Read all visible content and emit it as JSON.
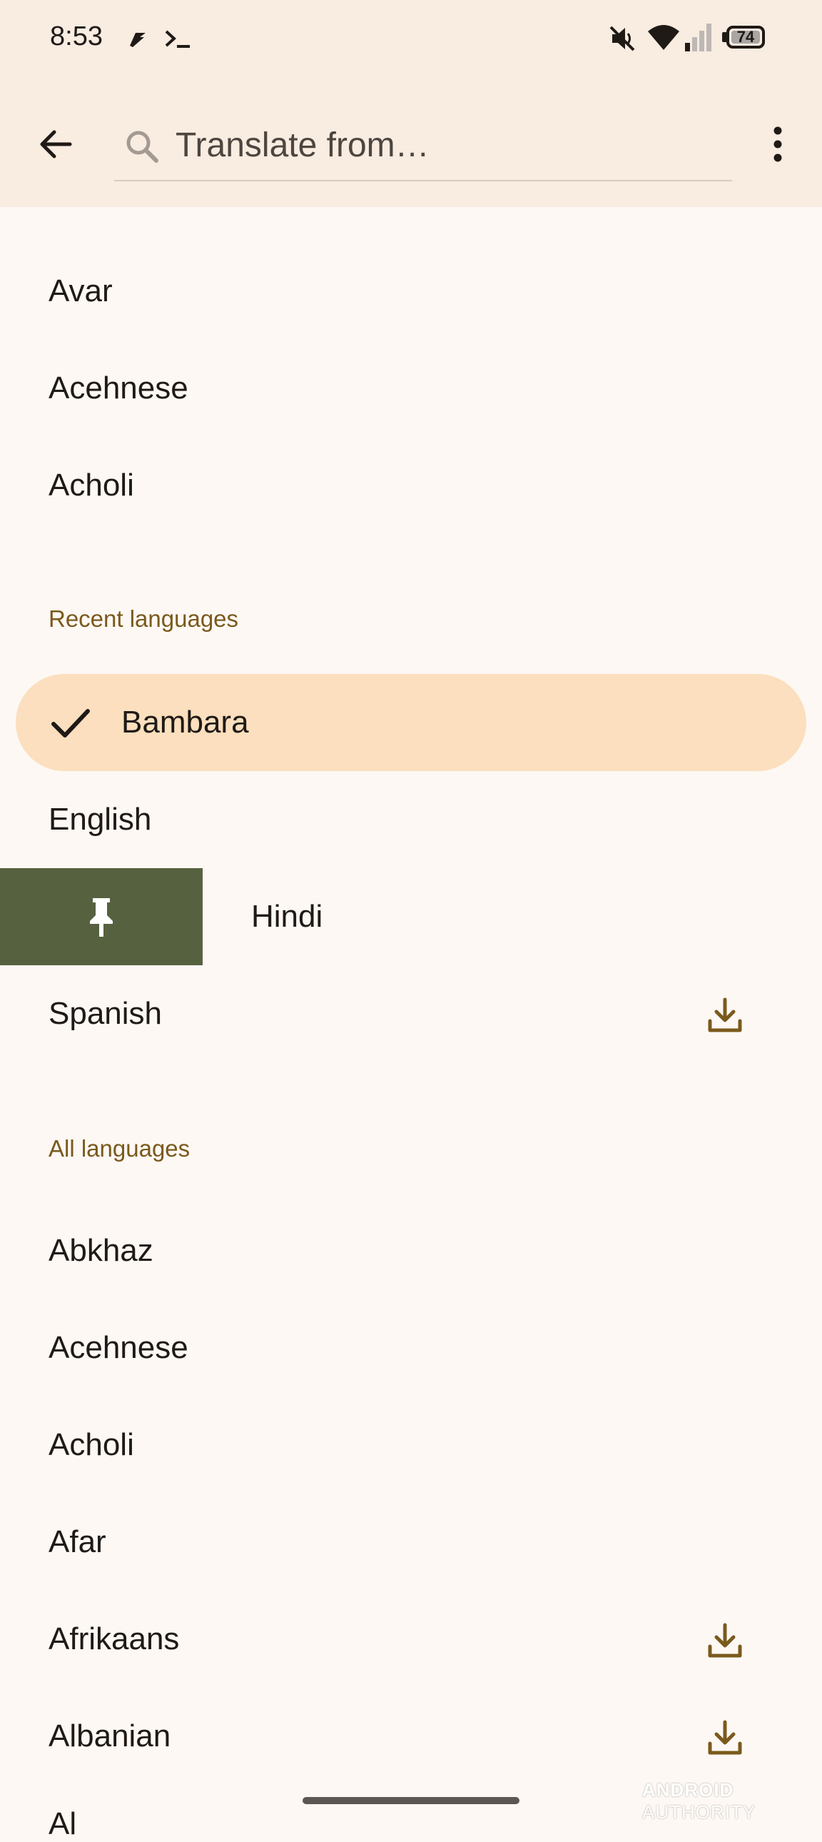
{
  "status_bar": {
    "time": "8:53",
    "battery": "74",
    "icons": [
      "messenger-icon",
      "terminal-icon",
      "mute-icon",
      "wifi-icon",
      "signal-icon",
      "battery-icon"
    ]
  },
  "app_bar": {
    "back_icon": "arrow-back-icon",
    "search_placeholder": "Translate from…",
    "menu_icon": "more-vert-icon"
  },
  "top_list": [
    "Avar",
    "Acehnese",
    "Acholi"
  ],
  "recent": {
    "header": "Recent languages",
    "selected": "Bambara",
    "items": [
      "English",
      "Hindi",
      "Spanish"
    ]
  },
  "all": {
    "header": "All languages",
    "items": [
      "Abkhaz",
      "Acehnese",
      "Acholi",
      "Afar",
      "Afrikaans",
      "Albanian"
    ],
    "peek": "Al"
  },
  "watermark": {
    "bold": "ANDROID",
    "thin": "AUTHORITY"
  },
  "colors": {
    "header_bg": "#f9ece1",
    "page_bg": "#fdf8f4",
    "selected_bg": "#fcdfbe",
    "pin_bg": "#566140",
    "accent": "#7a5a1c"
  }
}
